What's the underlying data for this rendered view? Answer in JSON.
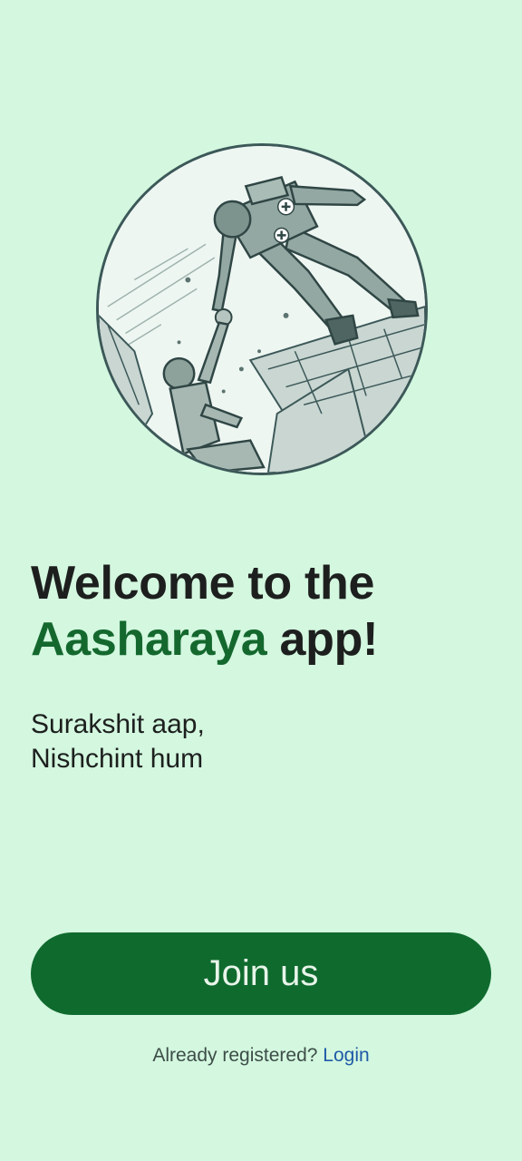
{
  "hero": {
    "icon": "rescue-illustration"
  },
  "welcome": {
    "prefix": "Welcome to the",
    "brand": "Aasharaya",
    "suffix": "app!"
  },
  "tagline": {
    "line1": "Surakshit aap,",
    "line2": "Nishchint hum"
  },
  "join_button": {
    "label": "Join us"
  },
  "login": {
    "prompt": "Already registered?",
    "link_label": "Login"
  },
  "colors": {
    "background": "#d3f7df",
    "brand_green": "#14682e",
    "button_green": "#0f6a2e",
    "link_blue": "#1f5aa6"
  }
}
